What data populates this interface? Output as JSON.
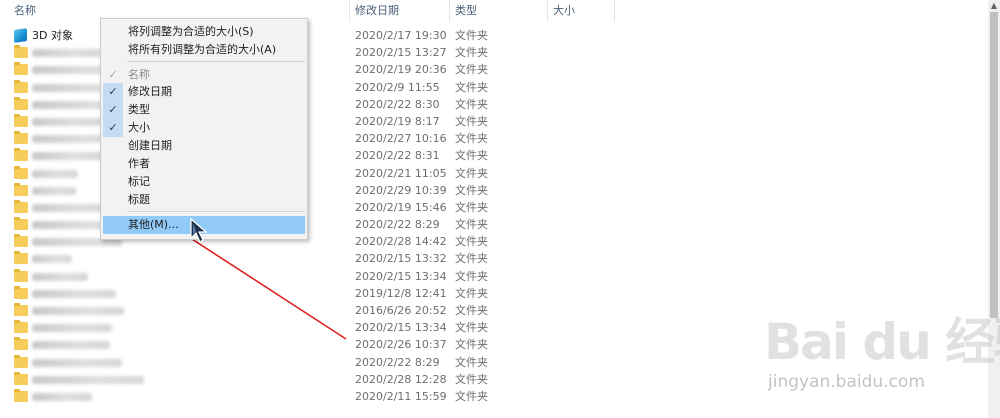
{
  "header": {
    "col_name": "名称",
    "col_date": "修改日期",
    "col_type": "类型",
    "col_size": "大小",
    "sort_indicator": "^"
  },
  "rows": [
    {
      "name": "3D 对象",
      "icon": "3d-objects-icon",
      "date": "2020/2/17 19:30",
      "type": "文件夹"
    },
    {
      "name": "",
      "icon": "folder-icon",
      "date": "2020/2/15 13:27",
      "type": "文件夹"
    },
    {
      "name": "",
      "icon": "folder-icon",
      "date": "2020/2/19 20:36",
      "type": "文件夹"
    },
    {
      "name": "",
      "icon": "folder-icon",
      "date": "2020/2/9 11:55",
      "type": "文件夹"
    },
    {
      "name": "",
      "icon": "folder-icon",
      "date": "2020/2/22 8:30",
      "type": "文件夹"
    },
    {
      "name": "",
      "icon": "folder-icon",
      "date": "2020/2/19 8:17",
      "type": "文件夹"
    },
    {
      "name": "",
      "icon": "folder-icon",
      "date": "2020/2/27 10:16",
      "type": "文件夹"
    },
    {
      "name": "",
      "icon": "folder-icon",
      "date": "2020/2/22 8:31",
      "type": "文件夹"
    },
    {
      "name": "",
      "icon": "folder-icon",
      "date": "2020/2/21 11:05",
      "type": "文件夹"
    },
    {
      "name": "",
      "icon": "folder-icon",
      "date": "2020/2/29 10:39",
      "type": "文件夹"
    },
    {
      "name": "",
      "icon": "folder-icon",
      "date": "2020/2/19 15:46",
      "type": "文件夹"
    },
    {
      "name": "",
      "icon": "folder-icon",
      "date": "2020/2/22 8:29",
      "type": "文件夹"
    },
    {
      "name": "",
      "icon": "folder-icon",
      "date": "2020/2/28 14:42",
      "type": "文件夹"
    },
    {
      "name": "",
      "icon": "folder-icon",
      "date": "2020/2/15 13:32",
      "type": "文件夹"
    },
    {
      "name": "",
      "icon": "folder-icon",
      "date": "2020/2/15 13:34",
      "type": "文件夹"
    },
    {
      "name": "",
      "icon": "folder-icon",
      "date": "2019/12/8 12:41",
      "type": "文件夹"
    },
    {
      "name": "",
      "icon": "folder-icon",
      "date": "2016/6/26 20:52",
      "type": "文件夹"
    },
    {
      "name": "",
      "icon": "folder-icon",
      "date": "2020/2/15 13:34",
      "type": "文件夹"
    },
    {
      "name": "",
      "icon": "folder-icon",
      "date": "2020/2/26 10:37",
      "type": "文件夹"
    },
    {
      "name": "",
      "icon": "folder-icon",
      "date": "2020/2/22 8:29",
      "type": "文件夹"
    },
    {
      "name": "",
      "icon": "folder-icon",
      "date": "2020/2/28 12:28",
      "type": "文件夹"
    },
    {
      "name": "",
      "icon": "folder-icon",
      "date": "2020/2/11 15:59",
      "type": "文件夹"
    }
  ],
  "context_menu": {
    "items": [
      {
        "label": "将列调整为合适的大小(S)",
        "checked": false,
        "disabled": false
      },
      {
        "label": "将所有列调整为合适的大小(A)",
        "checked": false,
        "disabled": false
      },
      {
        "separator": true
      },
      {
        "label": "名称",
        "checked": true,
        "disabled": true
      },
      {
        "label": "修改日期",
        "checked": true,
        "disabled": false
      },
      {
        "label": "类型",
        "checked": true,
        "disabled": false
      },
      {
        "label": "大小",
        "checked": true,
        "disabled": false
      },
      {
        "label": "创建日期",
        "checked": false,
        "disabled": false
      },
      {
        "label": "作者",
        "checked": false,
        "disabled": false
      },
      {
        "label": "标记",
        "checked": false,
        "disabled": false
      },
      {
        "label": "标题",
        "checked": false,
        "disabled": false
      },
      {
        "separator": true
      },
      {
        "label": "其他(M)...",
        "checked": false,
        "disabled": false,
        "highlighted": true
      }
    ],
    "check_glyph": "✓"
  },
  "watermark": {
    "logo": "Bai du 经验",
    "url": "jingyan.baidu.com"
  },
  "colors": {
    "menu_highlight": "#91c9f7",
    "check_background": "#c5dbf3",
    "annotation_arrow": "#e02020",
    "folder": "#f6cd5a"
  }
}
